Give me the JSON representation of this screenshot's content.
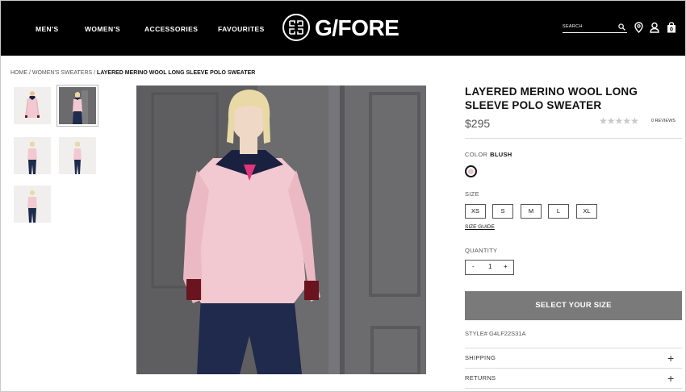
{
  "header": {
    "nav": [
      "MEN'S",
      "WOMEN'S",
      "ACCESSORIES",
      "FAVOURITES"
    ],
    "brand": "G/FORE",
    "search_placeholder": "SEARCH"
  },
  "breadcrumb": {
    "items": [
      "HOME",
      "WOMEN'S SWEATERS"
    ],
    "separator": "/",
    "current": "LAYERED MERINO WOOL LONG SLEEVE POLO SWEATER"
  },
  "product": {
    "title": "LAYERED MERINO WOOL LONG SLEEVE POLO SWEATER",
    "price": "$295",
    "rating_stars": "★★★★★",
    "reviews": "0 REVIEWS",
    "color_label": "COLOR",
    "color_value": "BLUSH",
    "swatch_color": "#e8c7cc",
    "size_label": "SIZE",
    "sizes": [
      "XS",
      "S",
      "M",
      "L",
      "XL"
    ],
    "size_guide": "SIZE GUIDE",
    "quantity_label": "QUANTITY",
    "quantity": {
      "minus": "-",
      "value": "1",
      "plus": "+"
    },
    "cta": "SELECT YOUR SIZE",
    "style": "STYLE# G4LF22S31A",
    "accordions": [
      "SHIPPING",
      "RETURNS"
    ],
    "accordion_toggle": "+"
  },
  "colors": {
    "header_bg": "#000000",
    "cta_bg": "#7a7a7a",
    "sweater": "#f2c9d0",
    "pants": "#1f2a4c",
    "collar": "#1a2040",
    "cuff": "#6a1420",
    "wall": "#6c6c6e"
  }
}
